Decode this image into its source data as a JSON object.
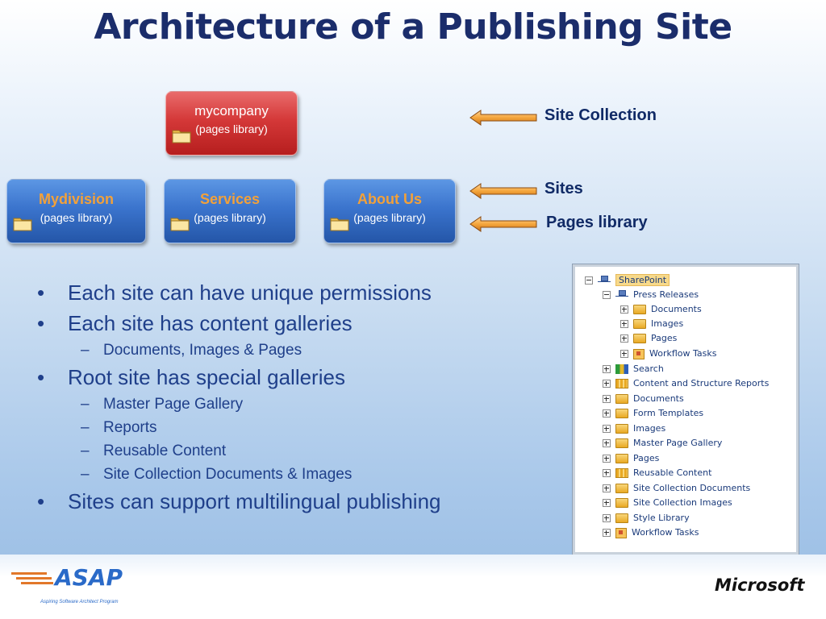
{
  "slide": {
    "title": "Architecture of a Publishing Site"
  },
  "site_boxes": [
    {
      "name": "mycompany",
      "sub": "(pages library)",
      "color": "#d43838"
    },
    {
      "name": "Mydivision",
      "sub": "(pages library)",
      "color": "#3b74cd"
    },
    {
      "name": "Services",
      "sub": "(pages library)",
      "color": "#3b74cd"
    },
    {
      "name": "About Us",
      "sub": "(pages library)",
      "color": "#3b74cd"
    }
  ],
  "labels": {
    "site_collection": "Site Collection",
    "sites": "Sites",
    "pages_library": "Pages library"
  },
  "bullets": {
    "b1": "Each site can have unique permissions",
    "b2": "Each site has content galleries",
    "b2_1": "Documents, Images & Pages",
    "b3": "Root site has special galleries",
    "b3_1": "Master Page Gallery",
    "b3_2": "Reports",
    "b3_3": "Reusable Content",
    "b3_4": "Site Collection Documents & Images",
    "b4": "Sites can support multilingual publishing"
  },
  "tree": {
    "root": "SharePoint",
    "press_releases": "Press Releases",
    "pr_children": [
      "Documents",
      "Images",
      "Pages",
      "Workflow Tasks"
    ],
    "items": [
      "Search",
      "Content and Structure Reports",
      "Documents",
      "Form Templates",
      "Images",
      "Master Page Gallery",
      "Pages",
      "Reusable Content",
      "Site Collection Documents",
      "Site Collection Images",
      "Style Library",
      "Workflow Tasks"
    ]
  },
  "footer": {
    "asap_logo": "ASAP",
    "asap_tagline": "Aspiring Software Architect Program",
    "microsoft_logo": "Microsoft"
  },
  "colors": {
    "title": "#1b2d6b",
    "bullet_text": "#1f3f8a",
    "label_text": "#102a66",
    "accent_orange": "#f2a13a"
  }
}
